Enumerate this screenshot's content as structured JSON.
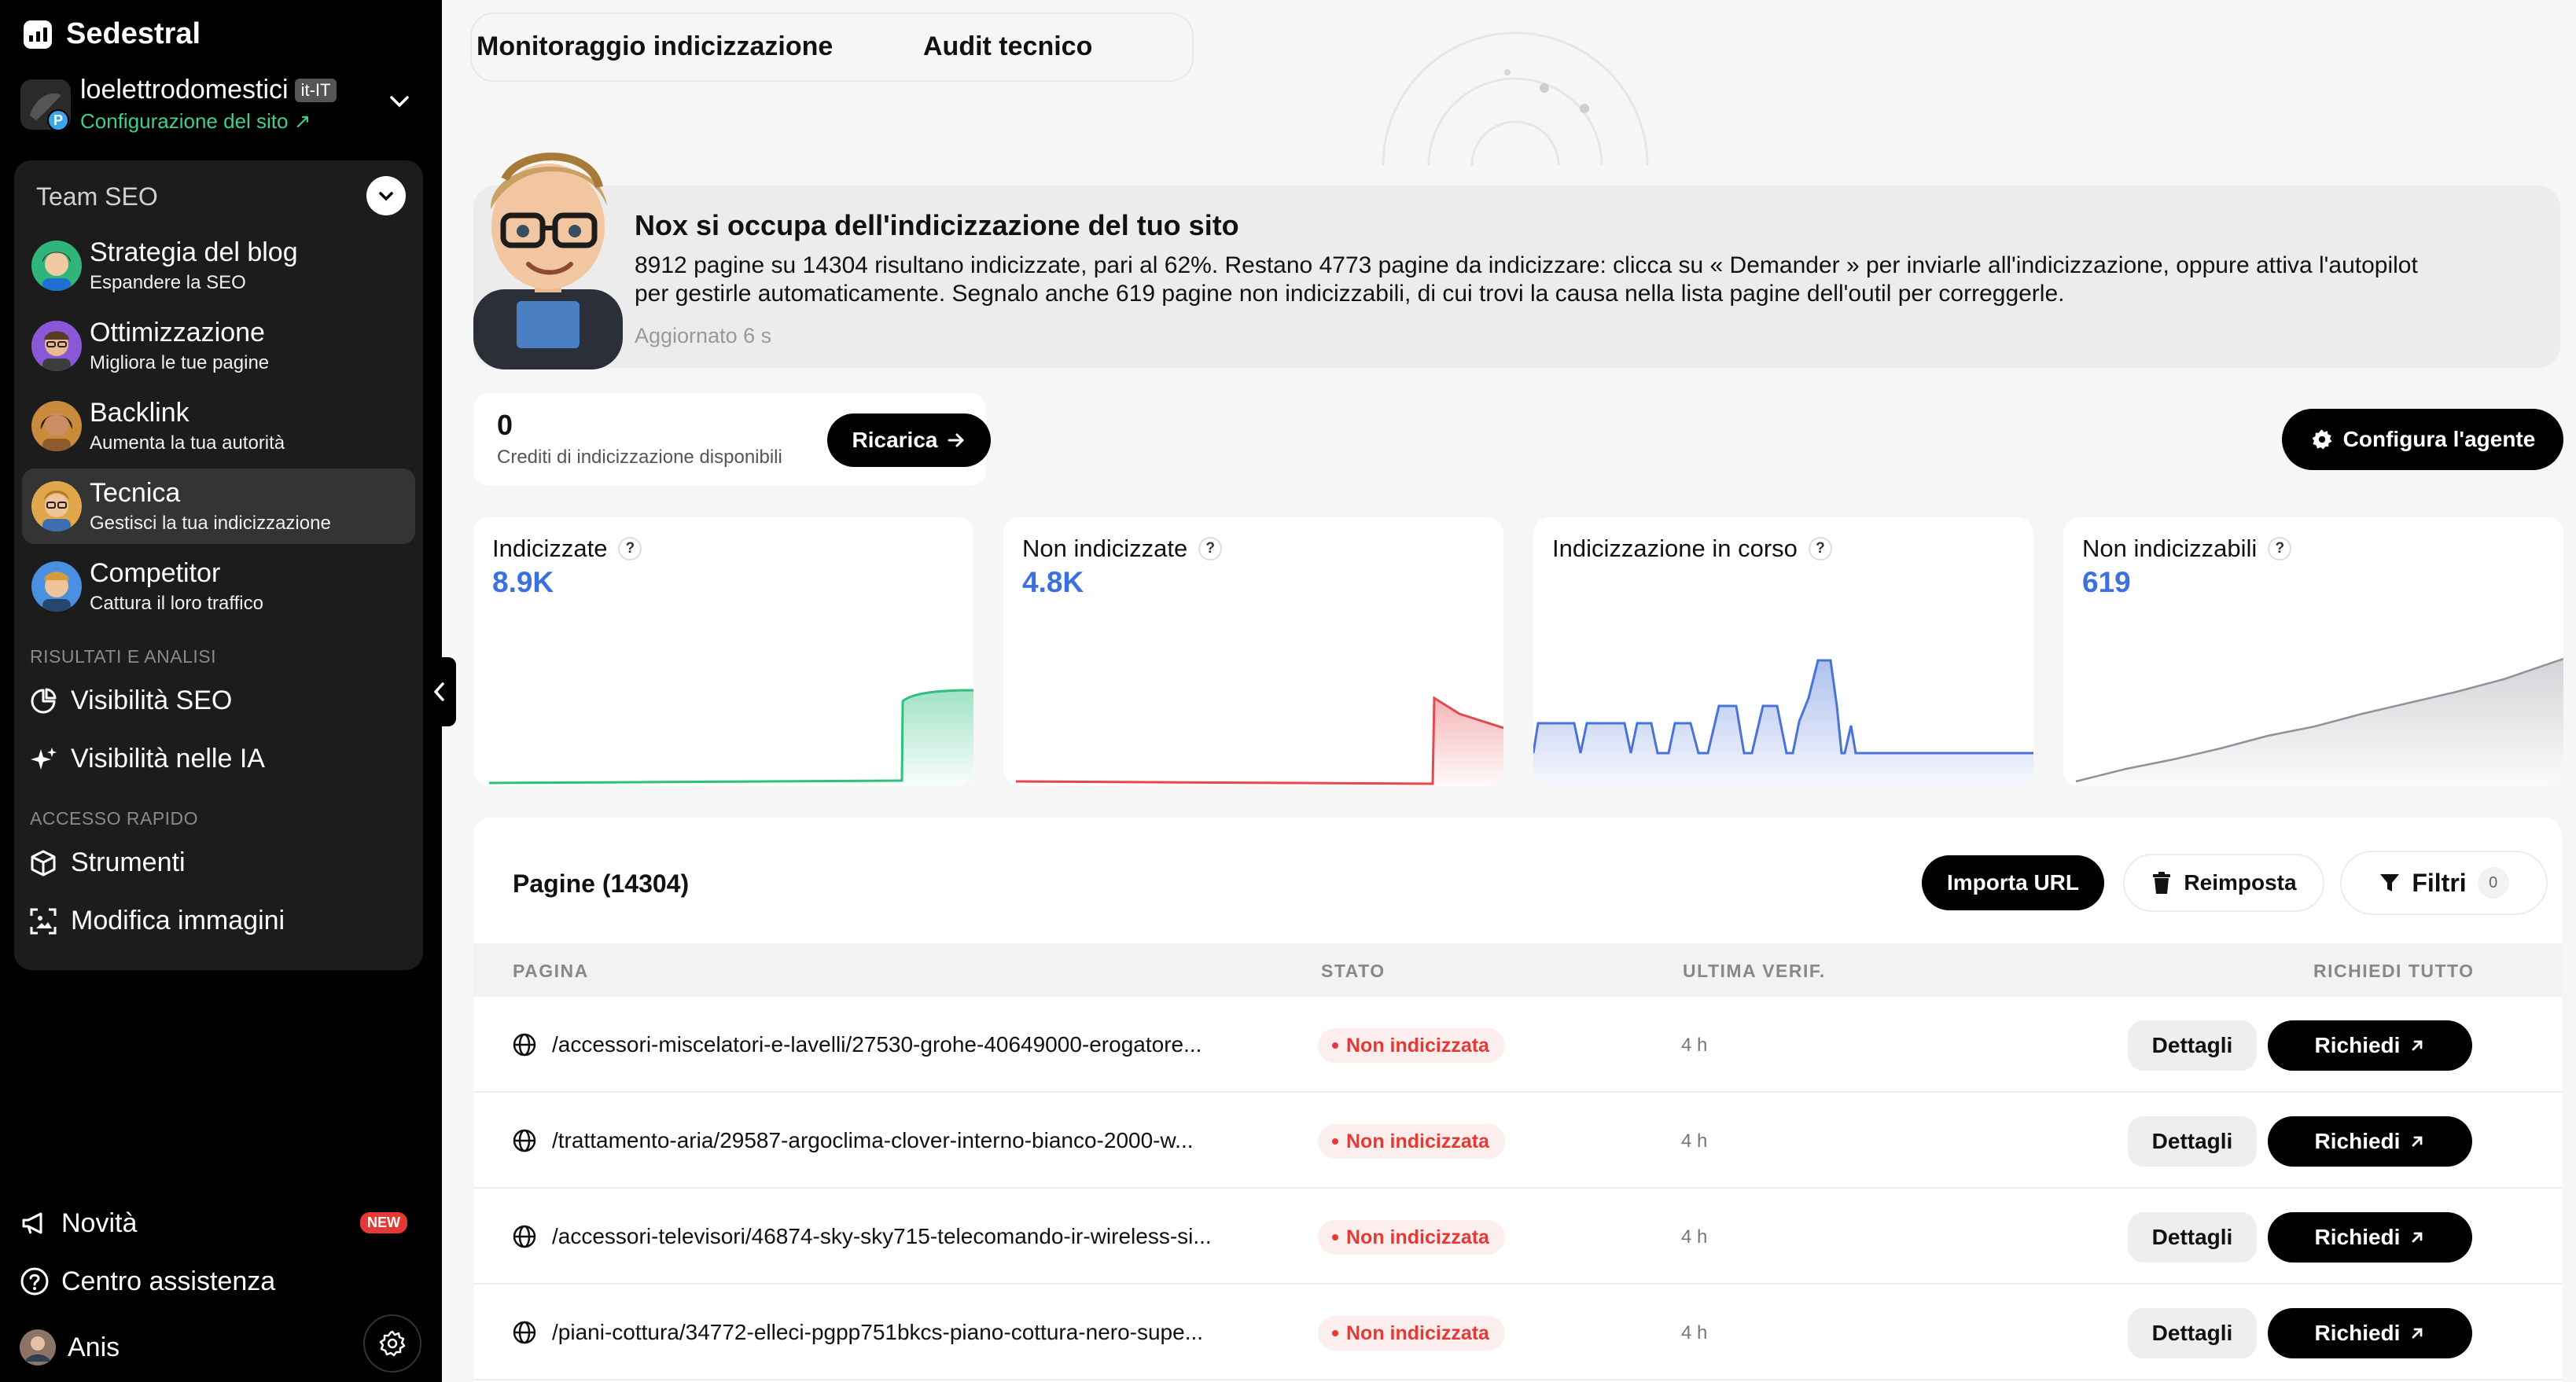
{
  "app": {
    "brand": "Sedestral"
  },
  "site": {
    "name": "loelettrodomestici",
    "lang": "it-IT",
    "config_link": "Configurazione del sito ↗",
    "avatar_badge": "P"
  },
  "team": {
    "title": "Team SEO",
    "agents": [
      {
        "name": "Strategia del blog",
        "desc": "Espandere la SEO",
        "color": "#2fb57a"
      },
      {
        "name": "Ottimizzazione",
        "desc": "Migliora le tue pagine",
        "color": "#8a57d6"
      },
      {
        "name": "Backlink",
        "desc": "Aumenta la tua autorità",
        "color": "#c98a3b"
      },
      {
        "name": "Tecnica",
        "desc": "Gestisci la tua indicizzazione",
        "color": "#e0a84b"
      },
      {
        "name": "Competitor",
        "desc": "Cattura il loro traffico",
        "color": "#4b8fe0"
      }
    ],
    "section_results": "RISULTATI E ANALISI",
    "results": [
      "Visibilità SEO",
      "Visibilità nelle IA"
    ],
    "section_quick": "ACCESSO RAPIDO",
    "quick": [
      "Strumenti",
      "Modifica immagini"
    ]
  },
  "footer_nav": {
    "news": "Novità",
    "news_badge": "NEW",
    "help": "Centro assistenza",
    "user": "Anis"
  },
  "tabs": [
    "Monitoraggio indicizzazione",
    "Audit tecnico"
  ],
  "banner": {
    "title": "Nox si occupa dell'indicizzazione del tuo sito",
    "text": "8912 pagine su 14304 risultano indicizzate, pari al 62%. Restano 4773 pagine da indicizzare: clicca su « Demander » per inviarle all'indicizzazione, oppure attiva l'autopilot per gestirle automaticamente. Segnalo anche 619 pagine non indicizzabili, di cui trovi la causa nella lista pagine dell'outil per correggerle.",
    "updated": "Aggiornato 6 s"
  },
  "credits": {
    "value": "0",
    "label": "Crediti di indicizzazione disponibili",
    "recharge": "Ricarica"
  },
  "config_agent": "Configura l'agente",
  "stats": [
    {
      "title": "Indicizzate",
      "value": "8.9K",
      "color": "#2fbf7f"
    },
    {
      "title": "Non indicizzate",
      "value": "4.8K",
      "color": "#e5484d"
    },
    {
      "title": "Indicizzazione in corso",
      "value": "",
      "color": "#4a73d8"
    },
    {
      "title": "Non indicizzabili",
      "value": "619",
      "color": "#9aa0a6"
    }
  ],
  "pages": {
    "title": "Pagine (14304)",
    "import": "Importa URL",
    "reset": "Reimposta",
    "filter": "Filtri",
    "filter_count": "0",
    "columns": [
      "PAGINA",
      "STATO",
      "ULTIMA VERIF.",
      "RICHIEDI TUTTO"
    ],
    "rows": [
      {
        "url": "/accessori-miscelatori-e-lavelli/27530-grohe-40649000-erogatore...",
        "status": "Non indicizzata",
        "last": "4 h"
      },
      {
        "url": "/trattamento-aria/29587-argoclima-clover-interno-bianco-2000-w...",
        "status": "Non indicizzata",
        "last": "4 h"
      },
      {
        "url": "/accessori-televisori/46874-sky-sky715-telecomando-ir-wireless-si...",
        "status": "Non indicizzata",
        "last": "4 h"
      },
      {
        "url": "/piani-cottura/34772-elleci-pgpp751bkcs-piano-cottura-nero-supe...",
        "status": "Non indicizzata",
        "last": "4 h"
      }
    ],
    "details_label": "Dettagli",
    "request_label": "Richiedi"
  }
}
